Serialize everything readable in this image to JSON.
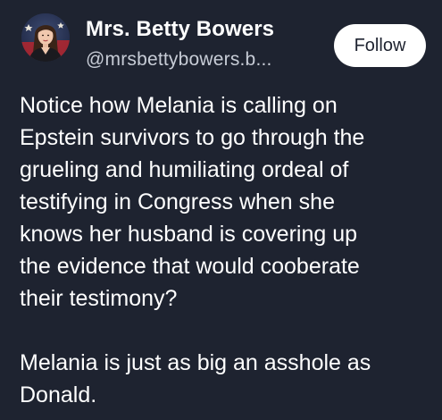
{
  "author": {
    "display_name": "Mrs. Betty Bowers",
    "handle": "@mrsbettybowers.b..."
  },
  "follow_button": {
    "label": "Follow"
  },
  "post": {
    "paragraph_1_lines": [
      "Notice how Melania is calling on",
      "Epstein survivors to go through the",
      "grueling and humiliating ordeal of",
      "testifying in Congress when she",
      "knows her husband is covering up",
      "the evidence that would cooberate",
      "their testimony?"
    ],
    "paragraph_2_lines": [
      "Melania is just as big an asshole as",
      "Donald."
    ]
  },
  "colors": {
    "background": "#1e2330",
    "text": "#ffffff",
    "handle_text": "#c7ccd6",
    "button_bg": "#ffffff"
  }
}
